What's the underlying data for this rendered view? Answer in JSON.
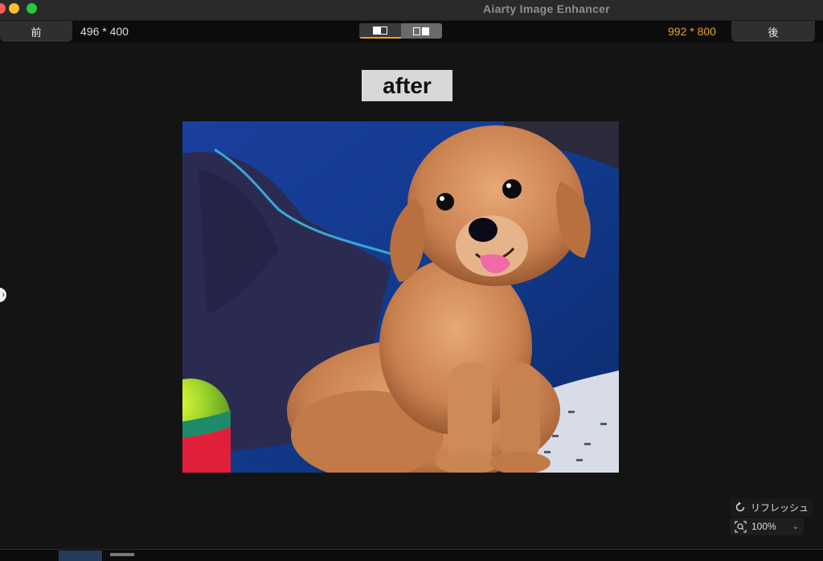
{
  "window": {
    "title": "Aiarty Image Enhancer"
  },
  "toolbar": {
    "before_tab": "前",
    "after_tab": "後",
    "left_resolution": "496 * 400",
    "right_resolution": "992 * 800"
  },
  "canvas": {
    "overlay_label": "after"
  },
  "controls": {
    "refresh_label": "リフレッシュ",
    "zoom_level": "100%"
  },
  "colors": {
    "accent": "#f0a020",
    "background": "#141414",
    "titlebar": "#2a2a2a"
  },
  "icons": [
    "refresh-icon",
    "zoom-icon",
    "chevron-down-icon",
    "single-view-icon",
    "split-view-icon"
  ]
}
